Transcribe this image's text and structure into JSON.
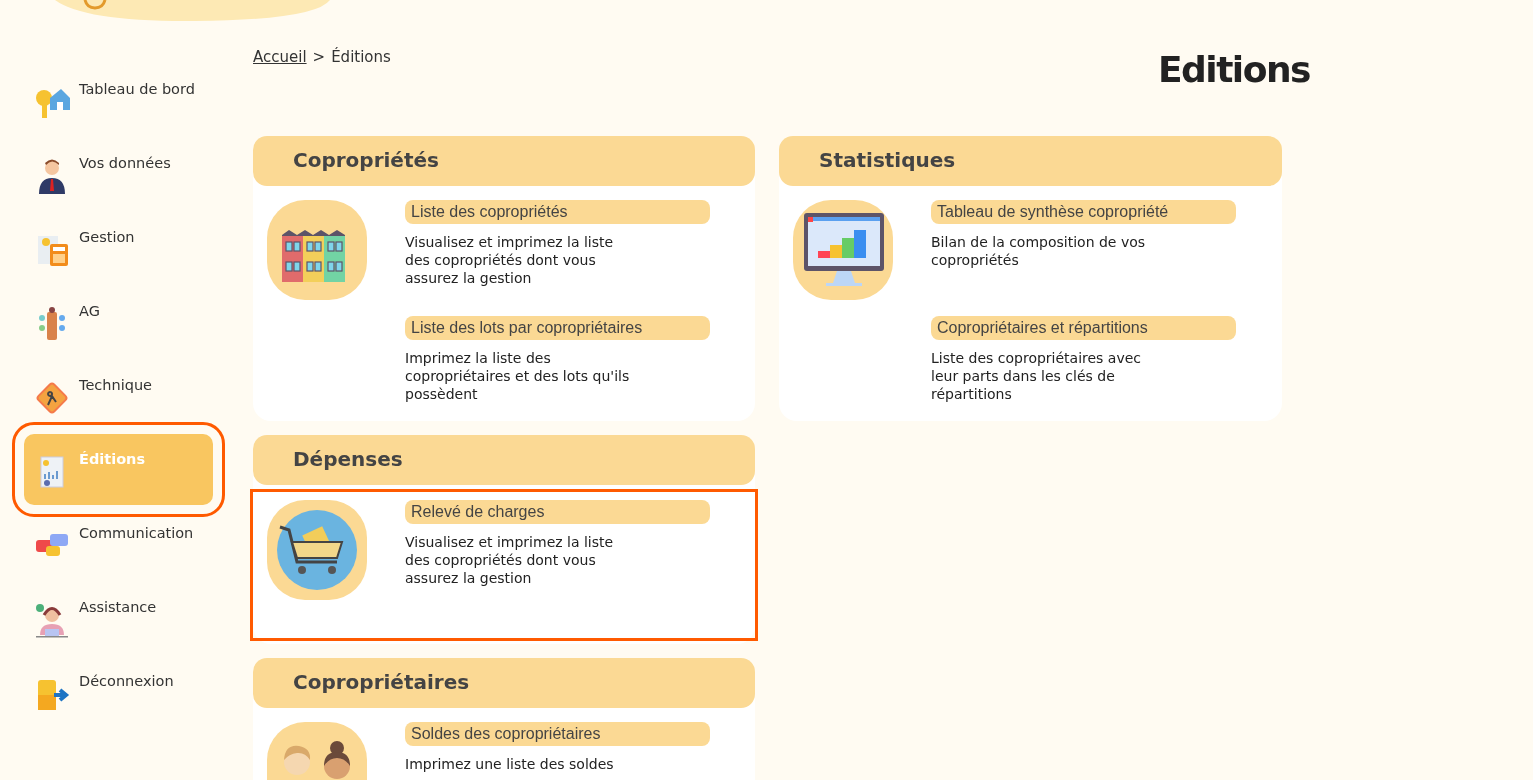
{
  "sidebar": {
    "items": [
      {
        "label": "Tableau de bord",
        "kind": "key-house",
        "selected": false,
        "highlighted": false
      },
      {
        "label": "Vos données",
        "kind": "person",
        "selected": false,
        "highlighted": false
      },
      {
        "label": "Gestion",
        "kind": "calculator",
        "selected": false,
        "highlighted": false
      },
      {
        "label": "AG",
        "kind": "meeting",
        "selected": false,
        "highlighted": false
      },
      {
        "label": "Technique",
        "kind": "worker-sign",
        "selected": false,
        "highlighted": false
      },
      {
        "label": "Éditions",
        "kind": "report",
        "selected": true,
        "highlighted": true
      },
      {
        "label": "Communication",
        "kind": "chat",
        "selected": false,
        "highlighted": false
      },
      {
        "label": "Assistance",
        "kind": "headset",
        "selected": false,
        "highlighted": false
      },
      {
        "label": "Déconnexion",
        "kind": "exit",
        "selected": false,
        "highlighted": false
      }
    ]
  },
  "breadcrumb": {
    "items": [
      {
        "label": "Accueil",
        "kind": "link"
      },
      {
        "label": ">",
        "kind": "separator"
      },
      {
        "label": "Éditions",
        "kind": "current"
      }
    ]
  },
  "page_title": "Editions",
  "left_column": {
    "cards": [
      {
        "title": "Copropriétés",
        "entries": [
          {
            "kind": "buildings",
            "title": "Liste des copropriétés",
            "description": "Visualisez et imprimez la liste des copropriétés dont vous assurez la gestion",
            "highlighted": false
          },
          {
            "title": "Liste des lots par copropriétaires",
            "description": "Imprimez la liste des copropriétaires et des lots qu'ils possèdent",
            "highlighted": false
          }
        ]
      },
      {
        "title": "Dépenses",
        "entries": [
          {
            "kind": "cart",
            "title": "Relevé de charges",
            "description": "Visualisez et imprimez la liste des copropriétés dont vous assurez la gestion",
            "highlighted": true
          }
        ]
      },
      {
        "title": "Copropriétaires",
        "entries": [
          {
            "kind": "couple",
            "title": "Soldes des copropriétaires",
            "description": "Imprimez une liste des soldes",
            "highlighted": false
          }
        ]
      }
    ]
  },
  "right_column": {
    "cards": [
      {
        "title": "Statistiques",
        "entries": [
          {
            "kind": "monitor-chart",
            "title": "Tableau de synthèse copropriété",
            "description": "Bilan de la composition de vos copropriétés",
            "highlighted": false
          },
          {
            "title": "Copropriétaires et répartitions",
            "description": "Liste des copropriétaires avec leur parts dans les clés de répartitions",
            "highlighted": false
          }
        ]
      }
    ]
  }
}
